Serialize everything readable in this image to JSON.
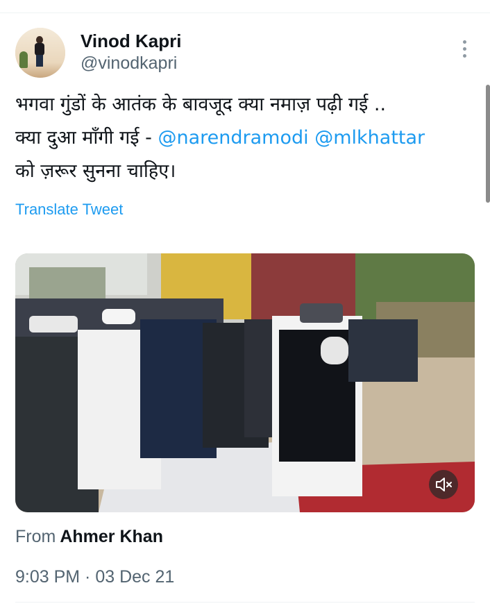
{
  "tweet": {
    "author": {
      "name": "Vinod Kapri",
      "handle": "@vinodkapri",
      "avatar_icon": "profile-photo"
    },
    "more_icon": "more-vertical-icon",
    "text": {
      "line1": "भगवा गुंडों के आतंक के बावजूद क्या नमाज़ पढ़ी गई ..",
      "line2_prefix": "क्या दुआ माँगी गई - ",
      "mention1": "@narendramodi",
      "mention2": "@mlkhattar",
      "line3": "को ज़रूर सुनना चाहिए।"
    },
    "translate_label": "Translate Tweet",
    "media": {
      "type": "video",
      "mute_icon": "speaker-muted-icon"
    },
    "attribution": {
      "label": "From",
      "name": "Ahmer Khan"
    },
    "timestamp": "9:03 PM · 03 Dec 21"
  },
  "colors": {
    "link": "#1d9bf0",
    "text_primary": "#0f1419",
    "text_secondary": "#536471"
  }
}
